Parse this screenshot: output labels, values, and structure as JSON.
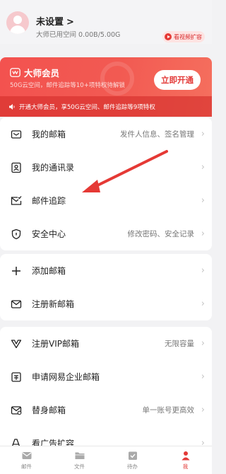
{
  "profile": {
    "name": "未设置",
    "storage": "大师已用空间 0.00B/5.00G",
    "video_expand": "看视频扩容"
  },
  "vip": {
    "title": "大师会员",
    "subtitle": "50G云空间，邮件追踪等10+项特权待解锁",
    "open_button": "立即开通",
    "notice": "开通大师会员，享50G云空间、邮件追踪等9项特权"
  },
  "group1": [
    {
      "icon": "mailbox-icon",
      "label": "我的邮箱",
      "hint": "发件人信息、签名管理"
    },
    {
      "icon": "contacts-icon",
      "label": "我的通讯录",
      "hint": ""
    },
    {
      "icon": "mail-tracking-icon",
      "label": "邮件追踪",
      "hint": ""
    },
    {
      "icon": "shield-icon",
      "label": "安全中心",
      "hint": "修改密码、安全记录"
    }
  ],
  "group2": [
    {
      "icon": "plus-icon",
      "label": "添加邮箱",
      "hint": ""
    },
    {
      "icon": "envelope-icon",
      "label": "注册新邮箱",
      "hint": ""
    }
  ],
  "group3": [
    {
      "icon": "vip-v-icon",
      "label": "注册VIP邮箱",
      "hint": "无限容量"
    },
    {
      "icon": "enterprise-icon",
      "label": "申请网易企业邮箱",
      "hint": ""
    },
    {
      "icon": "alias-mail-icon",
      "label": "替身邮箱",
      "hint": "单一账号更高效"
    },
    {
      "icon": "ad-expand-icon",
      "label": "看广告扩容",
      "hint": ""
    }
  ],
  "nav": [
    {
      "icon": "mail-icon",
      "label": "邮件"
    },
    {
      "icon": "folder-icon",
      "label": "文件"
    },
    {
      "icon": "todo-icon",
      "label": "待办"
    },
    {
      "icon": "me-icon",
      "label": "我"
    }
  ],
  "colors": {
    "accent": "#e33a38",
    "vip_gradient_start": "#f3524f",
    "vip_gradient_end": "#f56f5e",
    "background": "#f2f2f4"
  }
}
